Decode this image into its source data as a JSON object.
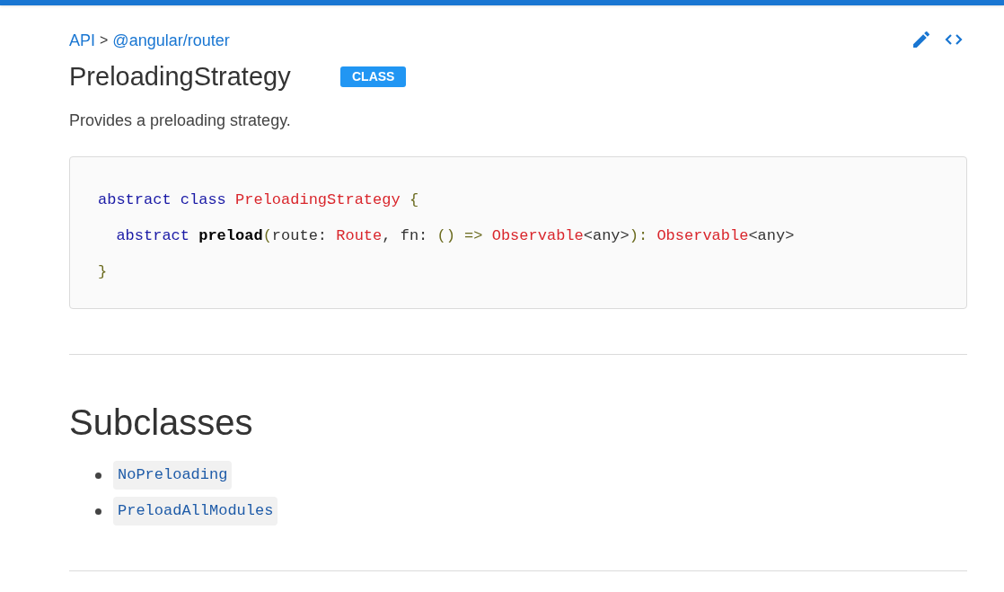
{
  "breadcrumb": [
    {
      "label": "API",
      "kind": "link"
    },
    {
      "label": ">",
      "kind": "separator"
    },
    {
      "label": "@angular/router",
      "kind": "link"
    }
  ],
  "title": "PreloadingStrategy",
  "badge": "CLASS",
  "description": "Provides a preloading strategy.",
  "code": [
    [
      {
        "text": "abstract class ",
        "kind": "keyword"
      },
      {
        "text": "PreloadingStrategy ",
        "kind": "type"
      },
      {
        "text": "{",
        "kind": "punct"
      }
    ],
    [
      {
        "text": "  abstract ",
        "kind": "keyword"
      },
      {
        "text": "preload",
        "kind": "name"
      },
      {
        "text": "(",
        "kind": "punct"
      },
      {
        "text": "route: ",
        "kind": "plain"
      },
      {
        "text": "Route",
        "kind": "type"
      },
      {
        "text": ", fn: ",
        "kind": "plain"
      },
      {
        "text": "() => ",
        "kind": "punct"
      },
      {
        "text": "Observable",
        "kind": "type"
      },
      {
        "text": "<any>",
        "kind": "plain"
      },
      {
        "text": "): ",
        "kind": "punct"
      },
      {
        "text": "Observable",
        "kind": "type"
      },
      {
        "text": "<any>",
        "kind": "plain"
      }
    ],
    [
      {
        "text": "}",
        "kind": "punct"
      }
    ]
  ],
  "section": {
    "heading": "Subclasses",
    "items": [
      "NoPreloading",
      "PreloadAllModules"
    ]
  }
}
